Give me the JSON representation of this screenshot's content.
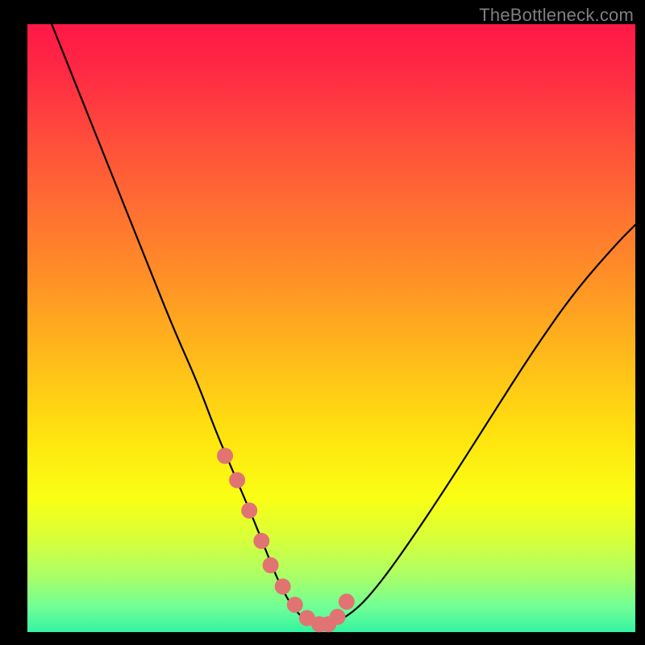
{
  "watermark": "TheBottleneck.com",
  "colors": {
    "black": "#000000",
    "curve": "#000000",
    "marker": "#e27373",
    "gradient_stops": [
      {
        "offset": 0.0,
        "color": "#ff1846"
      },
      {
        "offset": 0.08,
        "color": "#ff2a44"
      },
      {
        "offset": 0.18,
        "color": "#ff4a3c"
      },
      {
        "offset": 0.3,
        "color": "#ff6e32"
      },
      {
        "offset": 0.42,
        "color": "#ff9126"
      },
      {
        "offset": 0.55,
        "color": "#ffbb1a"
      },
      {
        "offset": 0.68,
        "color": "#ffe40f"
      },
      {
        "offset": 0.78,
        "color": "#f9ff14"
      },
      {
        "offset": 0.85,
        "color": "#d6ff3b"
      },
      {
        "offset": 0.91,
        "color": "#a8ff68"
      },
      {
        "offset": 0.96,
        "color": "#6fff97"
      },
      {
        "offset": 1.0,
        "color": "#33f3a1"
      }
    ]
  },
  "chart_data": {
    "type": "line",
    "title": "",
    "xlabel": "",
    "ylabel": "",
    "xlim": [
      0,
      100
    ],
    "ylim": [
      0,
      100
    ],
    "series": [
      {
        "name": "bottleneck-curve",
        "x": [
          4,
          8,
          12,
          16,
          20,
          24,
          28,
          31,
          34,
          37,
          39,
          41,
          43,
          45,
          47,
          50,
          54,
          58,
          63,
          69,
          76,
          83,
          90,
          97,
          100
        ],
        "y": [
          100,
          90,
          80,
          70,
          60,
          50,
          41,
          33,
          26,
          19,
          14,
          9,
          5,
          2.5,
          1.3,
          1.2,
          3.5,
          8,
          15,
          24,
          35,
          46,
          56,
          64,
          67
        ]
      }
    ],
    "markers": {
      "name": "highlight-points",
      "x": [
        32.5,
        34.5,
        36.5,
        38.5,
        40.0,
        42.0,
        44.0,
        46.0,
        48.0,
        49.5,
        51.0,
        52.5
      ],
      "y": [
        29,
        25,
        20,
        15,
        11,
        7.5,
        4.5,
        2.3,
        1.3,
        1.3,
        2.5,
        5.0
      ]
    }
  }
}
